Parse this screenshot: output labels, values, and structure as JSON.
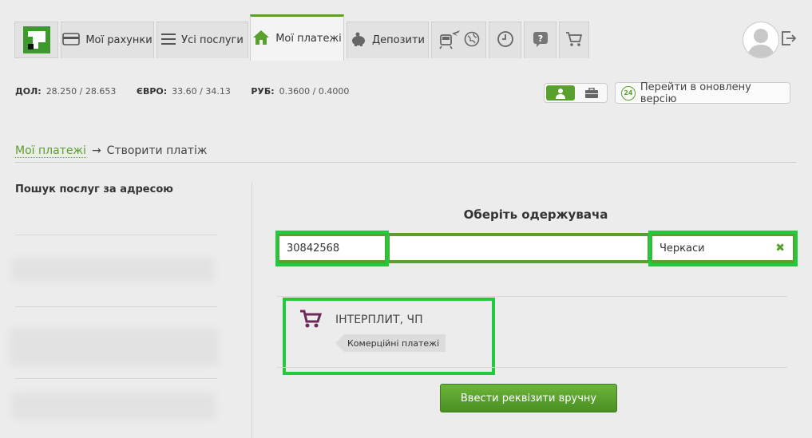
{
  "nav": {
    "tabs": [
      {
        "label": "Мої рахунки",
        "icon": "card-icon"
      },
      {
        "label": "Усі послуги",
        "icon": "list-icon"
      },
      {
        "label": "Мої платежі",
        "icon": "home-icon",
        "active": true
      },
      {
        "label": "Депозити",
        "icon": "piggy-bank-icon"
      }
    ],
    "icon_tabs": [
      "transport-icon",
      "globe-icon",
      "clock-icon",
      "help-icon",
      "cart-icon"
    ],
    "accent": "#5aa02c"
  },
  "rates": [
    {
      "name": "ДОЛ:",
      "value": "28.250 / 28.653"
    },
    {
      "name": "ЄВРО:",
      "value": "33.60 / 34.13"
    },
    {
      "name": "РУБ:",
      "value": "0.3600 / 0.4000"
    }
  ],
  "new_version": {
    "badge": "24",
    "label": "Перейти в оновлену версію"
  },
  "breadcrumb": {
    "link": "Мої платежі",
    "arrow": "→",
    "current": "Створити платіж"
  },
  "sidebar": {
    "title": "Пошук послуг за адресою"
  },
  "main": {
    "title": "Оберіть одержувача",
    "search": {
      "code": "30842568",
      "middle": "",
      "city": "Черкаси",
      "clear": "✖"
    },
    "result": {
      "name": "ІНТЕРПЛИТ, ЧП",
      "tag": "Комерційні платежі"
    },
    "button": "Ввести реквізити вручну"
  },
  "highlight_color": "#22c83d"
}
